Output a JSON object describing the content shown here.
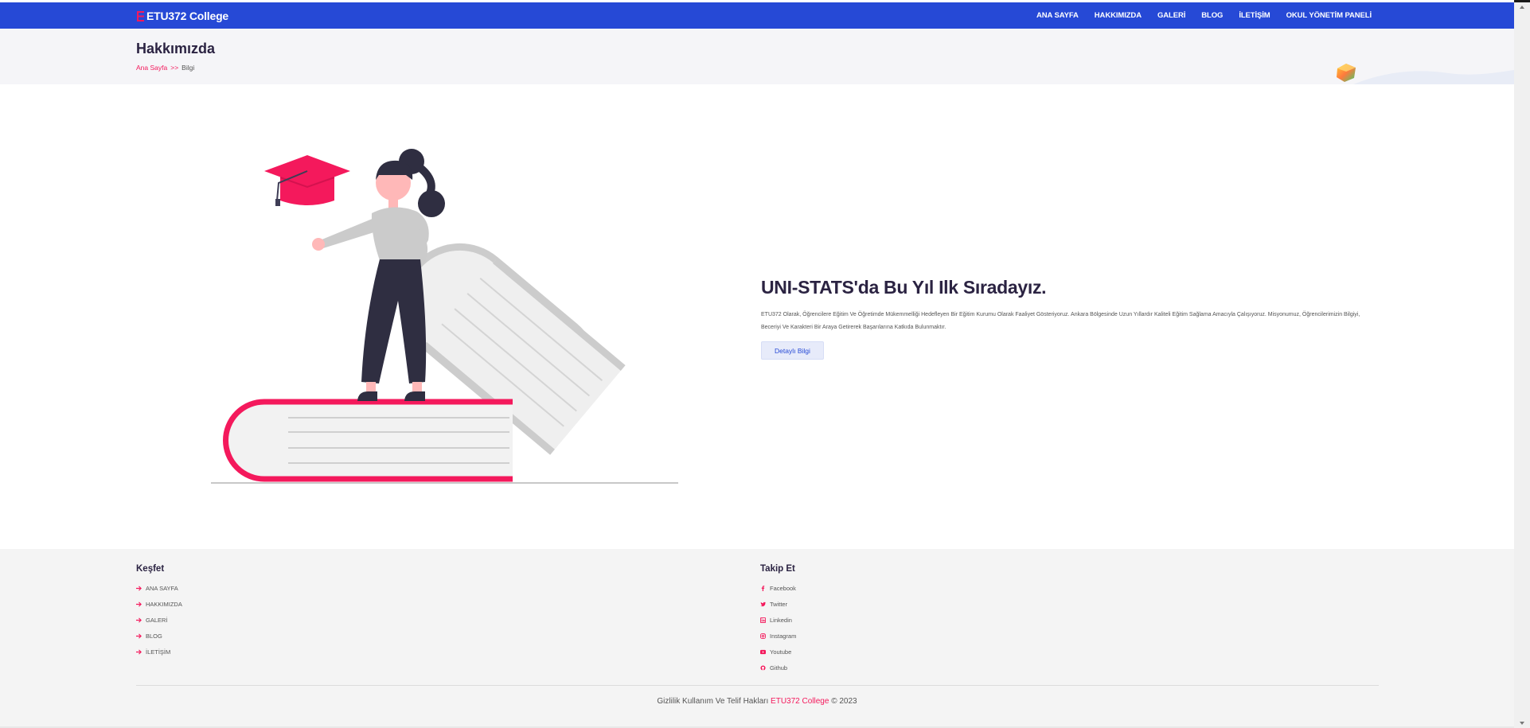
{
  "brand": {
    "name": "ETU372 College"
  },
  "nav": {
    "items": [
      "ANA SAYFA",
      "HAKKIMIZDA",
      "GALERİ",
      "BLOG",
      "İLETİŞİM",
      "OKUL YÖNETİM PANELİ"
    ]
  },
  "page_header": {
    "title": "Hakkımızda",
    "breadcrumb": {
      "home": "Ana Sayfa",
      "separator": ">>",
      "current": "Bilgi"
    }
  },
  "about": {
    "heading": "UNI-STATS'da Bu Yıl Ilk Sıradayız.",
    "text": "ETU372 Olarak, Öğrencilere Eğitim Ve Öğretimde Mükemmelliği Hedefleyen Bir Eğitim Kurumu Olarak Faaliyet Gösteriyoruz. Ankara Bölgesinde Uzun Yıllardır Kaliteli Eğitim Sağlama Amacıyla Çalışıyoruz. Misyonumuz, Öğrencilerimizin Bilgiyi, Beceriyi Ve Karakteri Bir Araya Getirerek Başarılarına Katkıda Bulunmaktır.",
    "button": "Detaylı Bilgi"
  },
  "footer": {
    "explore": {
      "heading": "Keşfet",
      "links": [
        "ANA SAYFA",
        "HAKKIMIZDA",
        "GALERİ",
        "BLOG",
        "İLETİŞİM"
      ]
    },
    "follow": {
      "heading": "Takip Et",
      "links": [
        "Facebook",
        "Twitter",
        "Linkedin",
        "Instagram",
        "Youtube",
        "Github"
      ]
    },
    "copyright": {
      "prefix": "Gizlilik Kullanım Ve Telif Hakları",
      "brand": "ETU372 College",
      "suffix": "© 2023"
    }
  },
  "colors": {
    "primary_blue": "#2649d6",
    "accent_pink": "#f4195c",
    "dark_text": "#2b2342",
    "header_bg": "#f5f5f8",
    "footer_bg": "#f4f4f4"
  },
  "icons": {
    "brand": "graduation-cap-icon",
    "footer_explore": "arrow-right-icon",
    "footer_follow": [
      "facebook-icon",
      "twitter-icon",
      "linkedin-icon",
      "instagram-icon",
      "youtube-icon",
      "github-icon"
    ]
  }
}
